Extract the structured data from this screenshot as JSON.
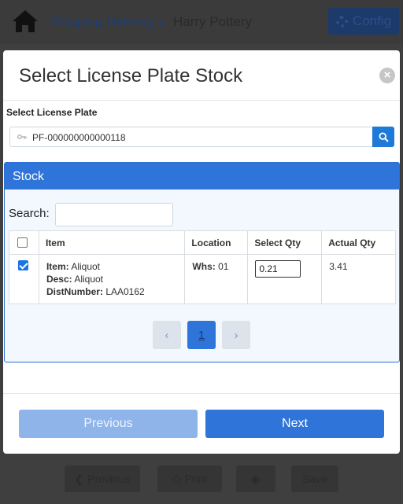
{
  "app": {
    "breadcrumb": "Shipping Delivery",
    "user_name": "Harry Pottery",
    "config_label": "Config"
  },
  "bottom_bar": {
    "previous_label": "Previous",
    "print_label": "Print",
    "save_label": "Save"
  },
  "modal": {
    "title": "Select License Plate Stock",
    "close_symbol": "×",
    "license_plate_label": "Select License Plate",
    "license_plate_value": "PF-000000000000118",
    "stock": {
      "heading": "Stock",
      "search_label": "Search:",
      "search_value": "",
      "columns": [
        "Item",
        "Location",
        "Select Qty",
        "Actual Qty"
      ],
      "rows": [
        {
          "checked": true,
          "item_label": "Item:",
          "item_value": "Aliquot",
          "desc_label": "Desc:",
          "desc_value": "Aliquot",
          "dist_label": "DistNumber:",
          "dist_value": "LAA0162",
          "whs_label": "Whs:",
          "whs_value": "01",
          "select_qty": "0.21",
          "actual_qty": "3.41"
        }
      ],
      "pagination": {
        "prev_symbol": "‹",
        "current_page": "1",
        "next_symbol": "›"
      }
    },
    "footer": {
      "previous_label": "Previous",
      "next_label": "Next"
    }
  },
  "colors": {
    "primary": "#2f74d8",
    "primary_disabled": "#8fb4ea",
    "overlay": "#3f3f3f"
  },
  "icons": [
    "home-icon",
    "chevron-down-icon",
    "gear-icon",
    "close-icon",
    "key-icon",
    "search-icon",
    "chevron-left-icon",
    "print-icon",
    "camera-icon"
  ]
}
